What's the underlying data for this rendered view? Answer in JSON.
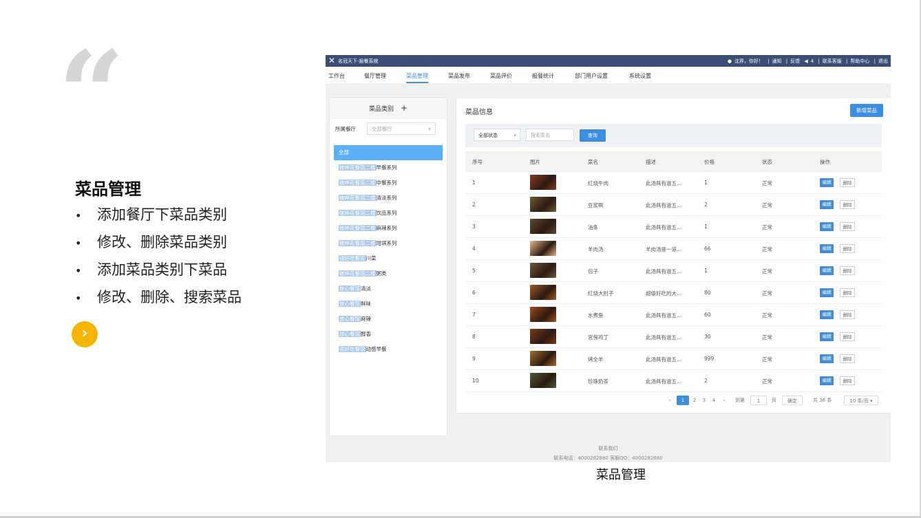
{
  "slide": {
    "quote_mark": "“",
    "title": "菜品管理",
    "bullets": [
      "添加餐厅下菜品类别",
      "修改、删除菜品类别",
      "添加菜品类别下菜品",
      "修改、删除、搜索菜品"
    ],
    "bullet_symbol": "•",
    "next_icon": "chevron-right-icon",
    "caption": "菜品管理",
    "accent_color": "#f5b400"
  },
  "app": {
    "name": "名冠天下-报餐系统",
    "logo_icon": "crossed-utensils-icon",
    "topbar_color": "#3a4d75",
    "user_greeting": "沈界，你好！",
    "links": [
      "通知",
      "反馈",
      "联系客服",
      "帮助中心",
      "退出"
    ],
    "notify_count": "4",
    "nav": [
      "工作台",
      "餐厅管理",
      "菜品管理",
      "菜品发布",
      "菜品评价",
      "报餐统计",
      "部门用户设置",
      "系统设置"
    ]
  },
  "sidebar": {
    "header": "菜品类别",
    "add_symbol": "+",
    "filter_label": "所属餐厅",
    "filter_value": "全部餐厅",
    "categories": [
      {
        "hl": "",
        "name": "全部"
      },
      {
        "hl": "彼岸花餐馆二楼",
        "name": "早餐系列"
      },
      {
        "hl": "彼岸花餐馆二楼",
        "name": "中餐系列"
      },
      {
        "hl": "彼岸花餐馆二楼",
        "name": "清淡系列"
      },
      {
        "hl": "彼岸花餐馆二楼",
        "name": "饮品系列"
      },
      {
        "hl": "彼岸花餐馆二楼",
        "name": "麻辣系列"
      },
      {
        "hl": "彼岸花餐馆二楼",
        "name": "坩埚系列"
      },
      {
        "hl": "很好吃餐馆",
        "name": "川菜"
      },
      {
        "hl": "彼岸花餐馆二楼",
        "name": "粥类"
      },
      {
        "hl": "放心餐馆",
        "name": "清淡"
      },
      {
        "hl": "放心餐馆",
        "name": "鲜味"
      },
      {
        "hl": "放心餐馆",
        "name": "麻辣"
      },
      {
        "hl": "放心餐馆",
        "name": "醇香"
      },
      {
        "hl": "很好吃餐馆",
        "name": "动感早餐"
      }
    ]
  },
  "main": {
    "title": "菜品信息",
    "new_button": "新增菜品",
    "status_filter": "全部状态",
    "search_placeholder": "搜索菜名",
    "query_button": "查询",
    "columns": [
      "序号",
      "图片",
      "菜名",
      "描述",
      "价格",
      "状态",
      "操作"
    ],
    "edit_label": "编辑",
    "delete_label": "删除",
    "rows": [
      {
        "no": "1",
        "name": "红烧牛肉",
        "desc": "此汤具有滋五…",
        "price": "1",
        "status": "正常",
        "img": "#8a3a22"
      },
      {
        "no": "2",
        "name": "豆浆啊",
        "desc": "此汤具有滋五…",
        "price": "2",
        "status": "正常",
        "img": "#6b5a32"
      },
      {
        "no": "3",
        "name": "油条",
        "desc": "此汤具有滋五…",
        "price": "1",
        "status": "正常",
        "img": "#5a4a30"
      },
      {
        "no": "4",
        "name": "羊肉汤",
        "desc": "羊肉汤是一道…",
        "price": "66",
        "status": "正常",
        "img": "#e8b48a"
      },
      {
        "no": "5",
        "name": "包子",
        "desc": "此汤具有滋五…",
        "price": "1",
        "status": "正常",
        "img": "#6a5a3a"
      },
      {
        "no": "6",
        "name": "红烧大肘子",
        "desc": "超级好吃的大…",
        "price": "80",
        "status": "正常",
        "img": "#9a5a2a"
      },
      {
        "no": "7",
        "name": "水煮鱼",
        "desc": "此汤具有滋五…",
        "price": "60",
        "status": "正常",
        "img": "#a04a20"
      },
      {
        "no": "8",
        "name": "宫保鸡丁",
        "desc": "此汤具有滋五…",
        "price": "30",
        "status": "正常",
        "img": "#7a3a1a"
      },
      {
        "no": "9",
        "name": "烤全羊",
        "desc": "此汤具有滋五…",
        "price": "999",
        "status": "正常",
        "img": "#a86a30"
      },
      {
        "no": "10",
        "name": "珍珠奶茶",
        "desc": "此汤具有滋五…",
        "price": "2",
        "status": "正常",
        "img": "#4a5a3a"
      }
    ],
    "pager": {
      "prev": "‹",
      "pages": [
        "1",
        "2",
        "3",
        "4"
      ],
      "next": "›",
      "goto_label": "到第",
      "goto_value": "1",
      "page_unit": "页",
      "confirm": "确定",
      "total": "共 36 条",
      "page_size": "10 条/页 ▾"
    }
  },
  "footer": {
    "contact_title": "联系我们",
    "contact_line": "联系电话：4000282880 客服QQ：4000282880"
  }
}
